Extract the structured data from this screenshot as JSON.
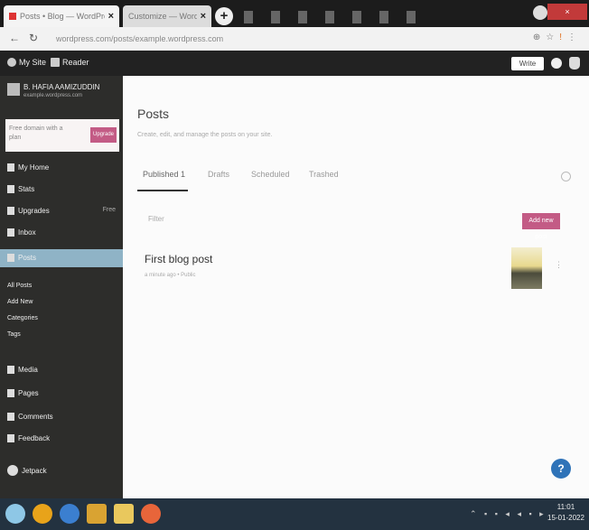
{
  "browser": {
    "tabs": [
      {
        "label": "Posts • Blog — WordPress.com"
      },
      {
        "label": "Customize — WordPress.com"
      }
    ],
    "new_tab": "+",
    "close_symbol": "×",
    "url": "wordpress.com/posts/example.wordpress.com",
    "window_close": "×"
  },
  "admin_bar": {
    "my_site": "My Site",
    "reader": "Reader",
    "write": "Write"
  },
  "sidebar": {
    "site_name": "B. HAFIA AAMIZUDDIN",
    "site_email": "example.wordpress.com",
    "upgrade_text": "Free domain with a plan",
    "upgrade_button": "Upgrade",
    "menu": [
      {
        "label": "My Home",
        "icon": "home-icon"
      },
      {
        "label": "Stats",
        "icon": "stats-icon"
      },
      {
        "label": "Upgrades",
        "icon": "upgrades-icon",
        "badge": "Free"
      },
      {
        "label": "Inbox",
        "icon": "inbox-icon"
      },
      {
        "label": "Posts",
        "icon": "posts-icon",
        "active": true
      }
    ],
    "submenu": [
      {
        "label": "All Posts"
      },
      {
        "label": "Add New"
      },
      {
        "label": "Categories"
      },
      {
        "label": "Tags"
      }
    ],
    "menu2": [
      {
        "label": "Media",
        "icon": "media-icon"
      },
      {
        "label": "Pages",
        "icon": "pages-icon"
      },
      {
        "label": "Comments",
        "icon": "comments-icon"
      },
      {
        "label": "Feedback",
        "icon": "feedback-icon"
      }
    ],
    "collapse": "Jetpack"
  },
  "main": {
    "title": "Posts",
    "subtitle": "Create, edit, and manage the posts on your site.",
    "tabs": [
      {
        "label": "Published 1",
        "active": true
      },
      {
        "label": "Drafts"
      },
      {
        "label": "Scheduled"
      },
      {
        "label": "Trashed"
      }
    ],
    "filter_label": "Filter",
    "add_button": "Add new post",
    "post": {
      "title": "First blog post",
      "meta": "a minute ago • Public"
    },
    "more": "⋮",
    "help": "?"
  },
  "taskbar": {
    "time": "11:01",
    "date": "15-01-2022"
  },
  "colors": {
    "accent": "#c35b85",
    "sidebar_bg": "#2d2d2b",
    "active_item": "#8fb3c6",
    "help": "#2f73b8"
  }
}
